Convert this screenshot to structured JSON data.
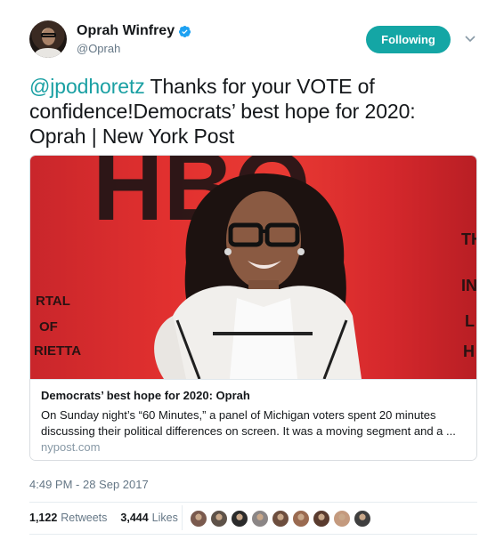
{
  "author": {
    "name": "Oprah Winfrey",
    "handle": "@Oprah",
    "verified": true
  },
  "follow_button": {
    "label": "Following",
    "color": "#14a6a5"
  },
  "tweet": {
    "mention": "@jpodhoretz",
    "text": " Thanks for your VOTE of confidence!Democrats’ best hope for 2020: Oprah | New York Post"
  },
  "card": {
    "title": "Democrats’ best hope for 2020: Oprah",
    "description": "On Sunday night’s “60 Minutes,” a panel of Michigan voters spent 20 minutes discussing their political differences on screen. It was a moving segment and a ...",
    "domain": "nypost.com",
    "image_backdrop_text": {
      "logo": "HBO",
      "left_lines": [
        "RTAL",
        "OF",
        "RIETTA"
      ],
      "right_lines": [
        "TH",
        "IN",
        "L",
        "H"
      ]
    }
  },
  "timestamp": "4:49 PM - 28 Sep 2017",
  "stats": {
    "retweets_count": "1,122",
    "retweets_label": "Retweets",
    "likes_count": "3,444",
    "likes_label": "Likes"
  },
  "liker_avatars": [
    "#7a5a4e",
    "#5e5249",
    "#2b2b2b",
    "#8b8686",
    "#6d4e3e",
    "#9a6a50",
    "#5a3b2e",
    "#c49a7e",
    "#3f3f3f"
  ],
  "icons": [
    "verified-badge-icon",
    "chevron-down-icon"
  ]
}
